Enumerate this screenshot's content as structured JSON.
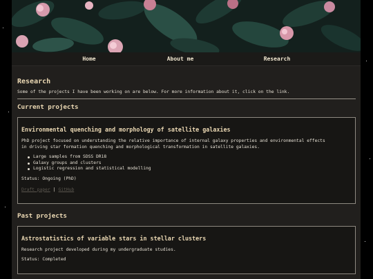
{
  "nav": {
    "items": [
      {
        "label": "Home"
      },
      {
        "label": "About me"
      },
      {
        "label": "Research"
      }
    ]
  },
  "page": {
    "title": "Research",
    "intro": "Some of the projects I have been working on are below. For more information about it, click on the link."
  },
  "current": {
    "heading": "Current projects",
    "project": {
      "title": "Environmental quenching and morphology of satellite galaxies",
      "desc_line1": "PhD project focused on understanding the relative importance of internal galaxy properties and environmental effects",
      "desc_line2": "in driving star formation quenching and morphological transformation in satellite galaxies.",
      "bullets": [
        "Large samples from SDSS DR18",
        "Galaxy groups and clusters",
        "Logistic regression and statistical modelling"
      ],
      "status": "Status: Ongoing (PhD)",
      "link_paper": "Draft paper",
      "link_sep": "|",
      "link_github": "GitHub"
    }
  },
  "past": {
    "heading": "Past projects",
    "project": {
      "title": "Astrostatistics of variable stars in stellar clusters",
      "desc": "Research project developed during my undergraduate studies.",
      "status": "Status: Completed"
    }
  },
  "colors": {
    "accent": "#ecd9b4",
    "background": "#211f1d",
    "card_bg": "#171614",
    "link_muted": "#5c5850"
  },
  "images": {
    "banner": "flowers-photo"
  }
}
